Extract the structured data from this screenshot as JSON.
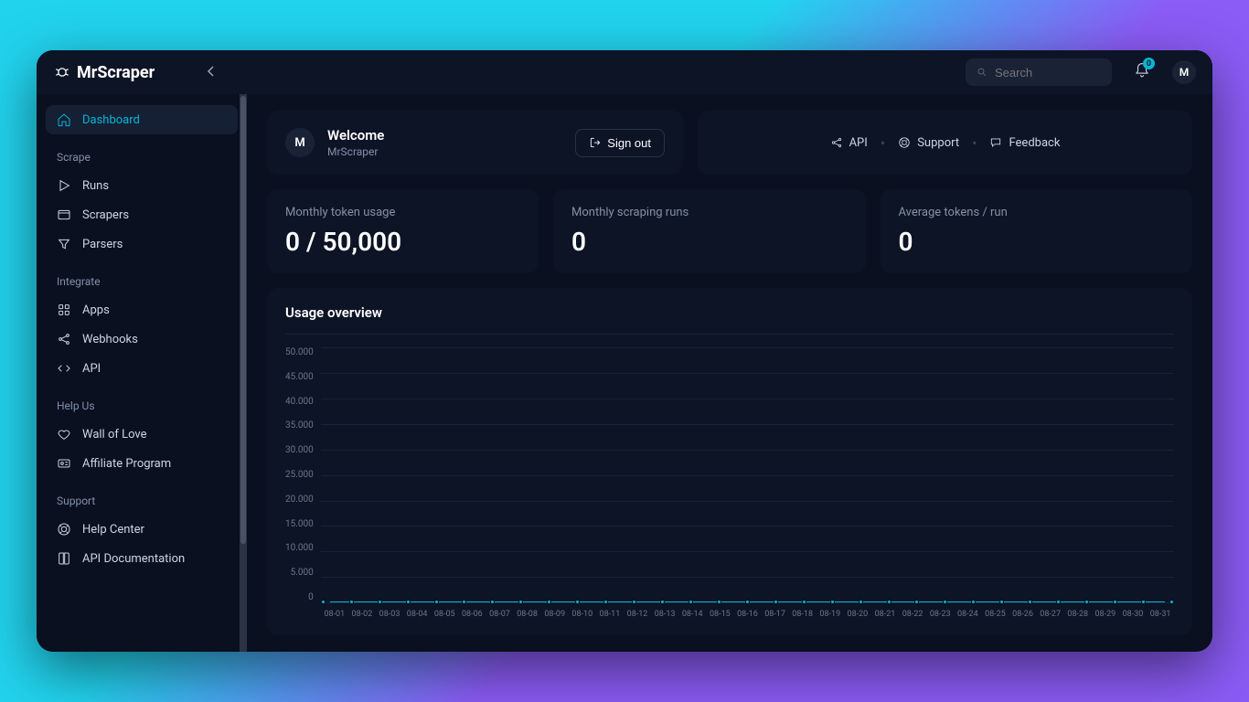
{
  "brand": "MrScraper",
  "search": {
    "placeholder": "Search"
  },
  "notifications": {
    "count": "0"
  },
  "user": {
    "initial": "M"
  },
  "sidebar": {
    "items": [
      {
        "label": "Dashboard",
        "active": true
      }
    ],
    "sections": [
      {
        "title": "Scrape",
        "items": [
          {
            "label": "Runs"
          },
          {
            "label": "Scrapers"
          },
          {
            "label": "Parsers"
          }
        ]
      },
      {
        "title": "Integrate",
        "items": [
          {
            "label": "Apps"
          },
          {
            "label": "Webhooks"
          },
          {
            "label": "API"
          }
        ]
      },
      {
        "title": "Help Us",
        "items": [
          {
            "label": "Wall of Love"
          },
          {
            "label": "Affiliate Program"
          }
        ]
      },
      {
        "title": "Support",
        "items": [
          {
            "label": "Help Center"
          },
          {
            "label": "API Documentation"
          }
        ]
      }
    ]
  },
  "welcome": {
    "title": "Welcome",
    "subtitle": "MrScraper",
    "avatar_initial": "M",
    "signout_label": "Sign out"
  },
  "links": {
    "api": "API",
    "support": "Support",
    "feedback": "Feedback"
  },
  "stats": {
    "token_usage": {
      "label": "Monthly token usage",
      "value": "0 / 50,000"
    },
    "scraping_runs": {
      "label": "Monthly scraping runs",
      "value": "0"
    },
    "avg_tokens": {
      "label": "Average tokens / run",
      "value": "0"
    }
  },
  "chart": {
    "title": "Usage overview"
  },
  "chart_data": {
    "type": "line",
    "title": "Usage overview",
    "xlabel": "",
    "ylabel": "",
    "ylim": [
      0,
      50000
    ],
    "y_ticks": [
      "50.000",
      "45.000",
      "40.000",
      "35.000",
      "30.000",
      "25.000",
      "20.000",
      "15.000",
      "10.000",
      "5.000",
      "0"
    ],
    "categories": [
      "08-01",
      "08-02",
      "08-03",
      "08-04",
      "08-05",
      "08-06",
      "08-07",
      "08-08",
      "08-09",
      "08-10",
      "08-11",
      "08-12",
      "08-13",
      "08-14",
      "08-15",
      "08-16",
      "08-17",
      "08-18",
      "08-19",
      "08-20",
      "08-21",
      "08-22",
      "08-23",
      "08-24",
      "08-25",
      "08-26",
      "08-27",
      "08-28",
      "08-29",
      "08-30",
      "08-31"
    ],
    "values": [
      0,
      0,
      0,
      0,
      0,
      0,
      0,
      0,
      0,
      0,
      0,
      0,
      0,
      0,
      0,
      0,
      0,
      0,
      0,
      0,
      0,
      0,
      0,
      0,
      0,
      0,
      0,
      0,
      0,
      0,
      0
    ],
    "color": "#06b6d4"
  }
}
